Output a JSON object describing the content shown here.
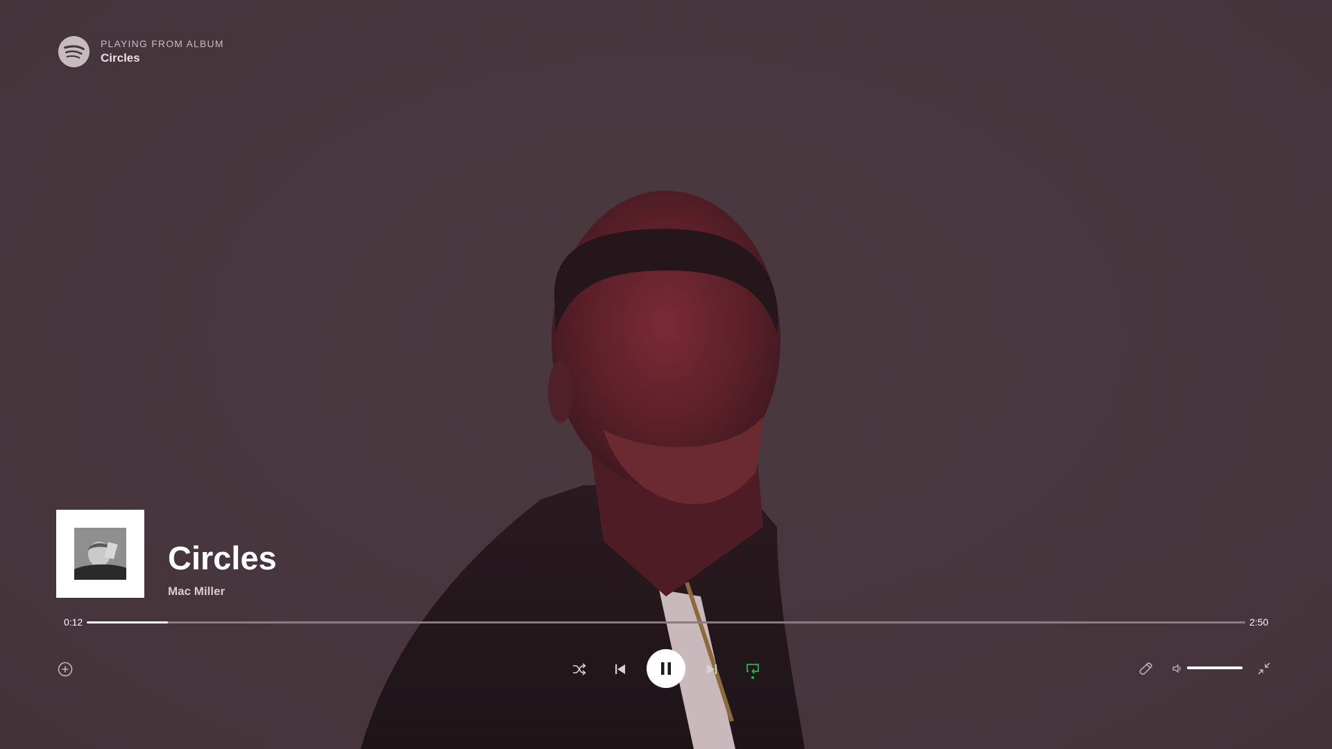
{
  "header": {
    "context_label": "PLAYING FROM ALBUM",
    "context_name": "Circles",
    "logo_icon": "spotify-logo-icon"
  },
  "track": {
    "title": "Circles",
    "artist": "Mac Miller"
  },
  "progress": {
    "elapsed": "0:12",
    "total": "2:50",
    "fraction": 0.07
  },
  "controls": {
    "add_icon": "plus-circle-icon",
    "shuffle_icon": "shuffle-icon",
    "previous_icon": "skip-back-icon",
    "play_pause_icon": "pause-icon",
    "next_icon": "skip-forward-icon",
    "repeat_icon": "repeat-icon",
    "repeat_active": true,
    "lyrics_icon": "microphone-icon",
    "volume_icon": "speaker-icon",
    "exit_fullscreen_icon": "minimize-icon"
  },
  "volume": {
    "level": 1.0
  },
  "colors": {
    "background": "#47363d",
    "accent": "#1db954",
    "text": "#ffffff",
    "muted_text": "#c8bcc1"
  }
}
